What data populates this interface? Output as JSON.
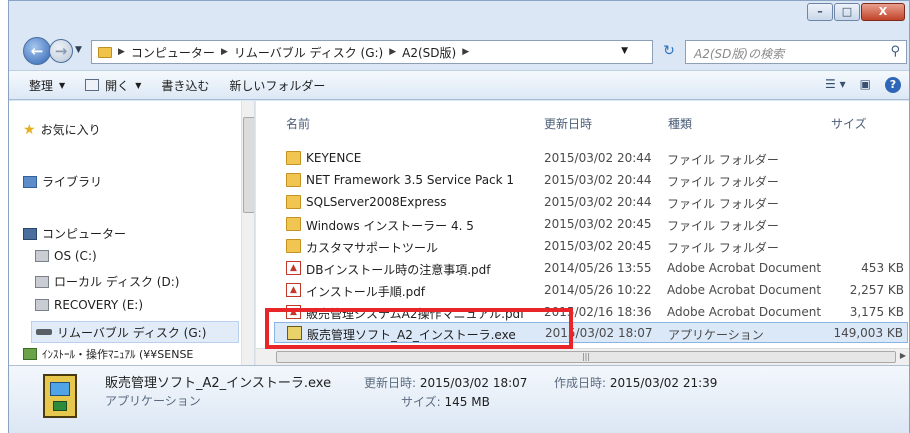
{
  "window": {
    "controls": {
      "minimize": "–",
      "maximize": "□",
      "close": "X"
    }
  },
  "address_bar": {
    "breadcrumbs": [
      "コンピューター",
      "リムーバブル ディスク (G:)",
      "A2(SD版)"
    ],
    "search_placeholder": "A2(SD版)の検索"
  },
  "toolbar": {
    "organize": "整理",
    "open": "開く",
    "burn": "書き込む",
    "new_folder": "新しいフォルダー"
  },
  "nav": {
    "favorites": "お気に入り",
    "libraries": "ライブラリ",
    "computer": "コンピューター",
    "drives": [
      "OS (C:)",
      "ローカル ディスク (D:)",
      "RECOVERY (E:)",
      "リムーバブル ディスク (G:)"
    ],
    "network": "ｲﾝｽﾄｰﾙ・操作ﾏﾆｭｱﾙ (¥¥SENSE"
  },
  "columns": {
    "name": "名前",
    "date": "更新日時",
    "type": "種類",
    "size": "サイズ"
  },
  "files": [
    {
      "name": "KEYENCE",
      "date": "2015/03/02 20:44",
      "type": "ファイル フォルダー",
      "size": "",
      "icon": "folder-icon"
    },
    {
      "name": "NET Framework 3.5 Service Pack 1",
      "date": "2015/03/02 20:44",
      "type": "ファイル フォルダー",
      "size": "",
      "icon": "folder-icon"
    },
    {
      "name": "SQLServer2008Express",
      "date": "2015/03/02 20:44",
      "type": "ファイル フォルダー",
      "size": "",
      "icon": "folder-icon"
    },
    {
      "name": "Windows インストーラー 4. 5",
      "date": "2015/03/02 20:45",
      "type": "ファイル フォルダー",
      "size": "",
      "icon": "folder-icon"
    },
    {
      "name": "カスタマサポートツール",
      "date": "2015/03/02 20:45",
      "type": "ファイル フォルダー",
      "size": "",
      "icon": "folder-icon"
    },
    {
      "name": "DBインストール時の注意事項.pdf",
      "date": "2014/05/26 13:55",
      "type": "Adobe Acrobat Document",
      "size": "453 KB",
      "icon": "pdf-icon"
    },
    {
      "name": "インストール手順.pdf",
      "date": "2014/05/26 10:22",
      "type": "Adobe Acrobat Document",
      "size": "2,257 KB",
      "icon": "pdf-icon"
    },
    {
      "name": "販売管理システムA2操作マニュアル.pdf",
      "date": "2015/02/16 18:36",
      "type": "Adobe Acrobat Document",
      "size": "3,175 KB",
      "icon": "pdf-icon"
    },
    {
      "name": "販売管理ソフト_A2_インストーラ.exe",
      "date": "2015/03/02 18:07",
      "type": "アプリケーション",
      "size": "149,003 KB",
      "icon": "exe-icon"
    }
  ],
  "details": {
    "name": "販売管理ソフト_A2_インストーラ.exe",
    "type": "アプリケーション",
    "modified_label": "更新日時:",
    "modified_value": "2015/03/02 18:07",
    "created_label": "作成日時:",
    "created_value": "2015/03/02 21:39",
    "size_label": "サイズ:",
    "size_value": "145 MB"
  }
}
